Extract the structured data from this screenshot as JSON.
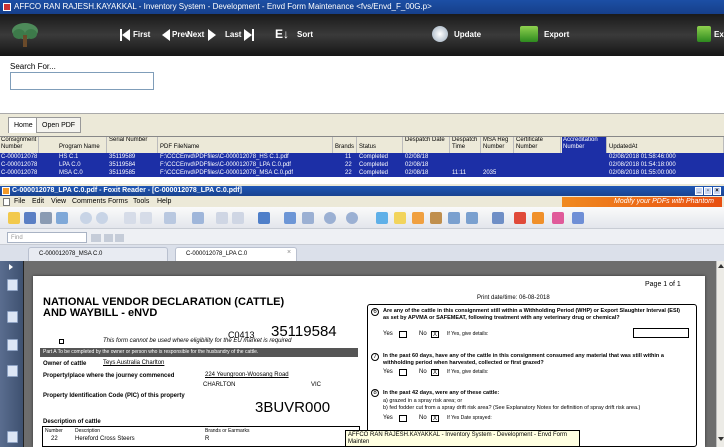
{
  "window": {
    "title": "AFFCO RAN RAJESH.KAYAKKAL - Inventory System - Development - Envd Form Maintenance <fvs/Envd_F_00G.p>"
  },
  "toolbar": {
    "first": "First",
    "prev": "Prev",
    "next": "Next",
    "last": "Last",
    "sort": "Sort",
    "update": "Update",
    "export": "Export",
    "exit": "Ex"
  },
  "search": {
    "label": "Search For...",
    "value": ""
  },
  "tabs": [
    "Home",
    "Open PDF"
  ],
  "grid": {
    "headers": [
      "Consignment Number",
      "Program Name",
      "Serial Number",
      "PDF FileName",
      "Brands",
      "Status",
      "Despatch Date",
      "Despatch Time",
      "MSA Reg Number",
      "Certificate Number",
      "Accreditation Number",
      "UpdatedAt"
    ],
    "rows": [
      [
        "C-000012078",
        "HS C.1",
        "35119589",
        "F:\\CCCEnvd\\PDFfiles\\C-000012078_HS C.1.pdf",
        "11",
        "Completed",
        "02/08/18",
        "",
        "",
        "",
        "",
        "02/08/2018 01:58:46:000"
      ],
      [
        "C-000012078",
        "LPA C.0",
        "35119584",
        "F:\\CCCEnvd\\PDFfiles\\C-000012078_LPA C.0.pdf",
        "22",
        "Completed",
        "02/08/18",
        "",
        "",
        "",
        "",
        "02/08/2018 01:54:18:000"
      ],
      [
        "C-000012078",
        "MSA C.0",
        "35119585",
        "F:\\CCCEnvd\\PDFfiles\\C-000012078_MSA C.0.pdf",
        "22",
        "Completed",
        "02/08/18",
        "11:11",
        "2035",
        "",
        "",
        "02/08/2018 01:55:00:000"
      ]
    ]
  },
  "foxit": {
    "title": "C-000012078_LPA C.0.pdf - Foxit Reader - [C-000012078_LPA C.0.pdf]",
    "menu": [
      "File",
      "Edit",
      "View",
      "Comments",
      "Forms",
      "Tools",
      "Help"
    ],
    "phantom": "Modify your PDFs with Phantom",
    "find_placeholder": "Find",
    "doc_tabs": [
      "C-000012078_MSA C.0",
      "C-000012078_LPA C.0"
    ]
  },
  "pdf": {
    "page_label": "Page 1 of 1",
    "print_datetime": "Print date/time:  06-08-2018",
    "title1": "NATIONAL VENDOR DECLARATION (CATTLE)",
    "title2": "AND WAYBILL - eNVD",
    "code": "C0413",
    "serial": "35119584",
    "eu_notice": "This form cannot be used where eligibility for the EU market is required",
    "part_a": "Part A  To be completed by the owner or person who is responsible for the husbandry of the cattle.",
    "owner_label": "Owner of cattle",
    "owner_value": "Teys Australia Charlton",
    "property_label": "Property/place where the journey commenced",
    "property_value": "224 Yeungroon-Woosang Road",
    "town": "CHARLTON",
    "state": "VIC",
    "pic_label": "Property Identification Code (PIC) of this property",
    "pic_value": "3BUVR000",
    "desc_label": "Description of cattle",
    "col_number": "Number",
    "col_description": "Description",
    "col_brands": "Brands or Earmarks",
    "row_number": "22",
    "row_description": "Hereford Cross Steers",
    "row_brand": "R",
    "q6": "Are any of the cattle in this consignment still within a Withholding Period (WHP) or Export Slaughter Interval (ESI) as set by APVMA or SAFEMEAT, following treatment with any veterinary drug or chemical?",
    "q7": "In the past 60 days, have any of the cattle in this consignment consumed any material that was still within a withholding period when harvested, collected or first grazed?",
    "q8": "In the past 42 days, were any of these cattle:",
    "q8a": "a) grazed in a spray risk area; or",
    "q8b": "b) fed fodder cut from a spray drift risk area? (See Explanatory Notes for definition of spray drift risk area.)",
    "yes": "Yes",
    "no": "No",
    "give_details": "If Yes, give details:",
    "date_sprayed": "If Yes Date sprayed:"
  },
  "tooltip": "AFFCO RAN RAJESH.KAYAKKAL - Inventory System - Development - Envd Form Mainten"
}
